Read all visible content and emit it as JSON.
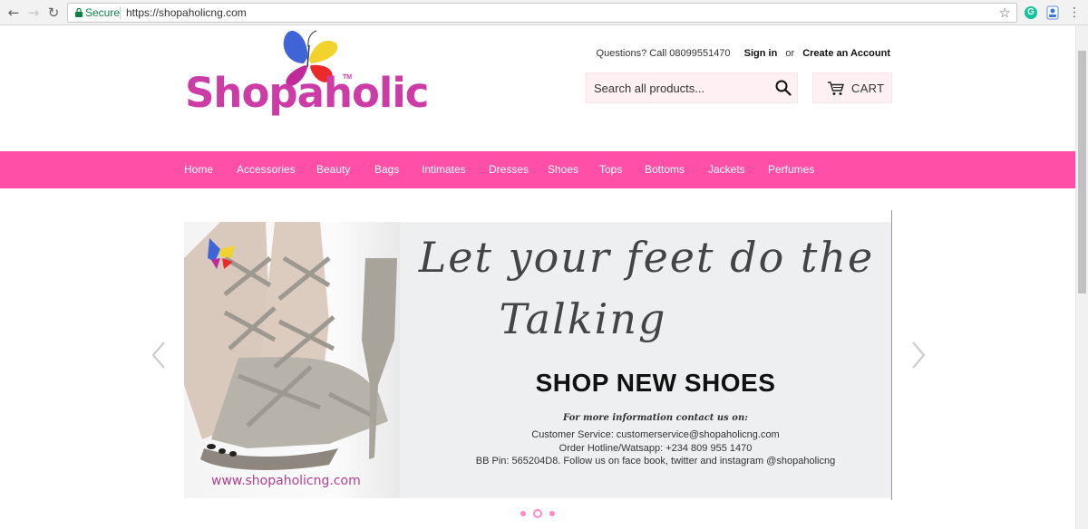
{
  "browser": {
    "back_icon": "arrow-left-icon",
    "forward_icon": "arrow-right-icon",
    "reload_icon": "reload-icon",
    "secure_label": "Secure",
    "url": "https://shopaholicng.com",
    "bookmark_icon": "star-icon",
    "extension_1": "G",
    "menu_icon": "kebab-menu-icon"
  },
  "header": {
    "logo_text": "Shopaholic",
    "logo_tm": "TM",
    "questions": "Questions? Call 08099551470",
    "sign_in": "Sign in",
    "or": "or",
    "create_account": "Create an Account",
    "search_placeholder": "Search all products...",
    "cart_label": "CART"
  },
  "nav": {
    "items": [
      "Home",
      "Accessories",
      "Beauty",
      "Bags",
      "Intimates",
      "Dresses",
      "Shoes",
      "Tops",
      "Bottoms",
      "Jackets",
      "Perfumes"
    ]
  },
  "slider": {
    "headline_1": "Let your feet do the",
    "headline_2": "Talking",
    "cta": "SHOP NEW SHOES",
    "more_info": "For more information contact us on:",
    "customer_service": "Customer Service: customerservice@shopaholicng.com",
    "hotline": "Order Hotline/Watsapp: +234 809 955 1470",
    "bb_pin": "BB Pin: 565204D8. Follow us on face book, twitter and instagram @shopaholicng",
    "watermark": "www.shopaholicng.com",
    "active_slide": 2,
    "slide_count": 3
  },
  "colors": {
    "brand_pink": "#ff4fa6",
    "logo_magenta": "#cc3ba6",
    "search_bg": "#fff0f4"
  }
}
